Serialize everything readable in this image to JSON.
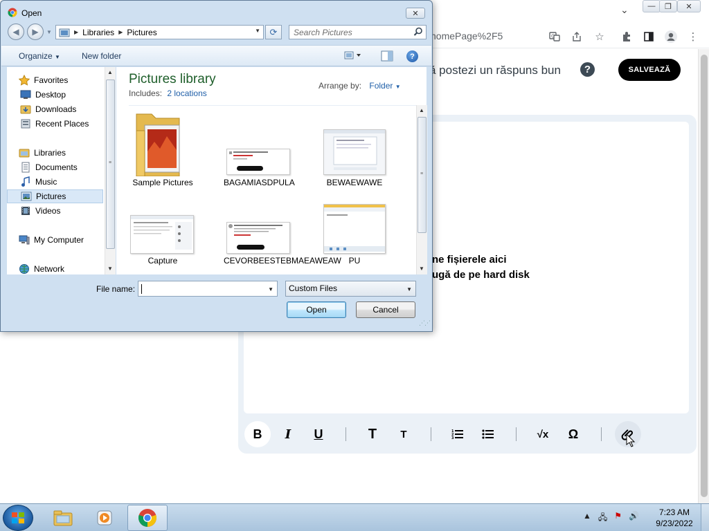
{
  "browser": {
    "url_fragment": "homePage%2F5",
    "header_text": "ă postezi un răspuns bun",
    "help_symbol": "?",
    "save_label": "SALVEAZĂ",
    "drop_lines": [
      "ne fișierele aici",
      "ugă de pe hard disk"
    ],
    "format_buttons": [
      "B",
      "I",
      "U",
      "T",
      "T",
      "ordered-list",
      "bullet-list",
      "√x",
      "Ω",
      "attachment"
    ]
  },
  "dialog": {
    "title": "Open",
    "address": [
      "Libraries",
      "Pictures"
    ],
    "search_placeholder": "Search Pictures",
    "toolbar": {
      "organize": "Organize",
      "new_folder": "New folder"
    },
    "nav": {
      "favorites": "Favorites",
      "favorites_items": [
        "Desktop",
        "Downloads",
        "Recent Places"
      ],
      "libraries": "Libraries",
      "libraries_items": [
        "Documents",
        "Music",
        "Pictures",
        "Videos"
      ],
      "computer": "My Computer",
      "network": "Network"
    },
    "library": {
      "title": "Pictures library",
      "includes_label": "Includes:",
      "includes_link": "2 locations",
      "arrange_label": "Arrange by:",
      "arrange_value": "Folder"
    },
    "files": [
      "Sample Pictures",
      "BAGAMIASDPULA",
      "BEWAEWAWE",
      "Capture",
      "CEVORBEESTEBMAEAWEAW",
      "PU"
    ],
    "file_name_label": "File name:",
    "file_name_value": "",
    "filter_value": "Custom Files",
    "open_label": "Open",
    "cancel_label": "Cancel"
  },
  "taskbar": {
    "time": "7:23 AM",
    "date": "9/23/2022"
  },
  "colors": {
    "dialog_bg": "#cfe0f1",
    "library_title": "#1e5e2a",
    "link": "#1f5fa8",
    "save_button": "#000000"
  }
}
